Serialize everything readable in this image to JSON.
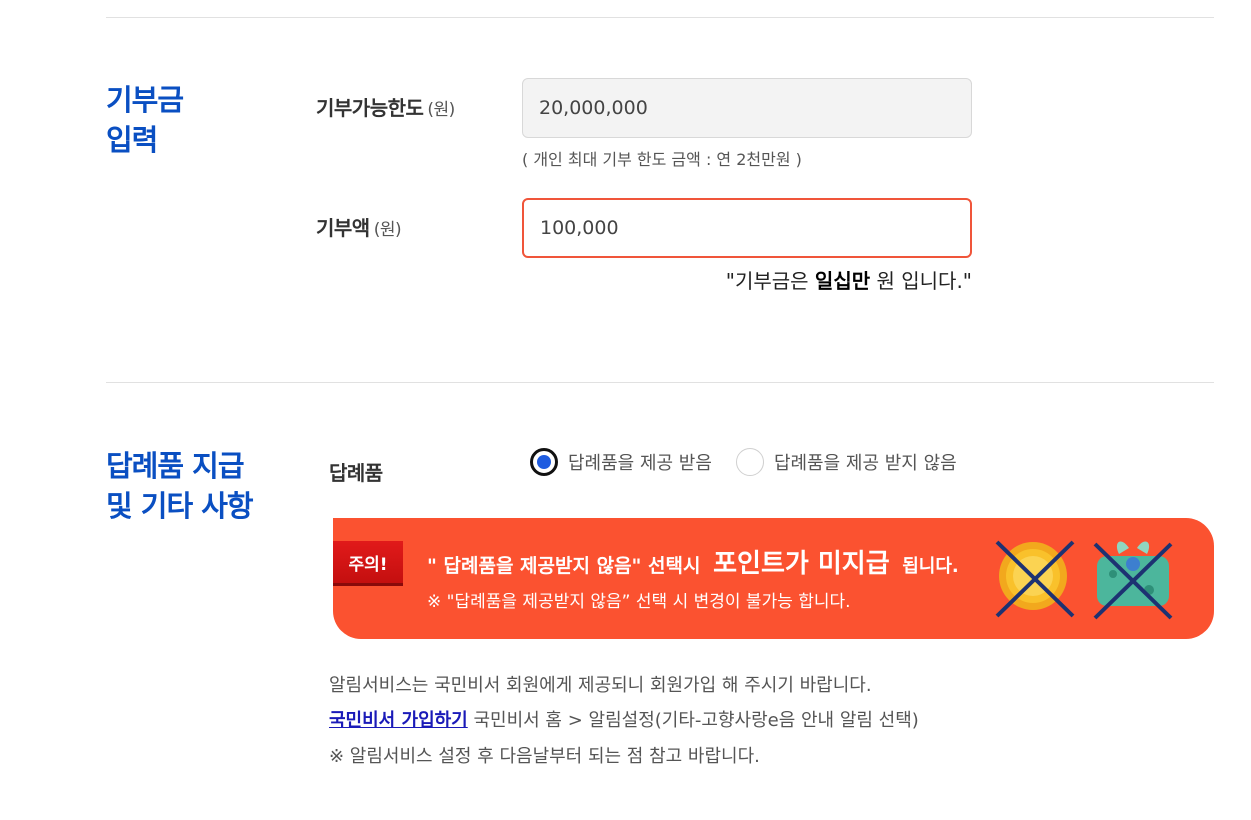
{
  "section_donation": {
    "title_line1": "기부금",
    "title_line2": "입력",
    "limit_label": "기부가능한도",
    "limit_unit": "(원)",
    "limit_value": "20,000,000",
    "limit_note": "( 개인 최대 기부 한도 금액 : 연 2천만원 )",
    "amount_label": "기부액",
    "amount_unit": "(원)",
    "amount_value": "100,000",
    "amount_text_prefix": "\"기부금은 ",
    "amount_text_bold": "일십만",
    "amount_text_suffix": " 원 입니다.\""
  },
  "section_gift": {
    "title_line1": "답례품 지급",
    "title_line2": "및 기타 사항",
    "gift_label": "답례품",
    "options": [
      {
        "label": "답례품을 제공 받음",
        "checked": true
      },
      {
        "label": "답례품을 제공 받지 않음",
        "checked": false
      }
    ],
    "notice": {
      "tag": "주의!",
      "line1_prefix": "\" 답례품을 제공받지 않음\" 선택시",
      "line1_big": "포인트가 미지급",
      "line1_suffix": "됩니다.",
      "line2": "※ \"답례품을 제공받지 않음” 선택 시 변경이 불가능 합니다.",
      "icons": [
        "point-coin-icon",
        "gift-package-icon"
      ]
    },
    "info_line1": "알림서비스는 국민비서 회원에게 제공되니 회원가입 해 주시기 바랍니다.",
    "info_link": "국민비서 가입하기",
    "info_line2_rest": " 국민비서 홈 > 알림설정(기타-고향사랑e음 안내 알림 선택)",
    "info_line3": "※ 알림서비스 설정 후 다음날부터 되는 점 참고 바랍니다."
  },
  "colors": {
    "accent_blue": "#0a4fc2",
    "alert_orange": "#fb5230",
    "active_border": "#f0553a",
    "radio_dot": "#1f5ce0"
  }
}
